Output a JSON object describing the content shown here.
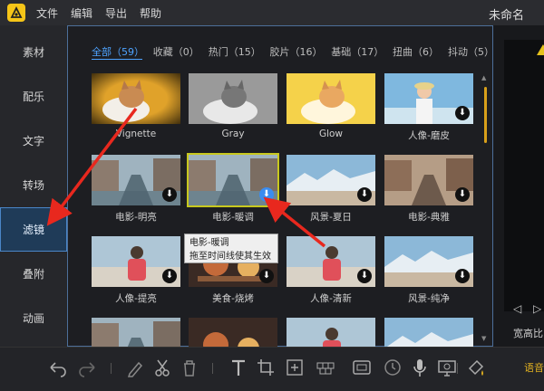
{
  "app": {
    "title": "未命名",
    "menu": [
      "文件",
      "编辑",
      "导出",
      "帮助"
    ]
  },
  "sidebar": {
    "items": [
      {
        "label": "素材",
        "active": false
      },
      {
        "label": "配乐",
        "active": false
      },
      {
        "label": "文字",
        "active": false
      },
      {
        "label": "转场",
        "active": false
      },
      {
        "label": "滤镜",
        "active": true
      },
      {
        "label": "叠附",
        "active": false
      },
      {
        "label": "动画",
        "active": false
      }
    ]
  },
  "filters": {
    "tabs": [
      {
        "label": "全部（59）",
        "active": true
      },
      {
        "label": "收藏（0）",
        "active": false
      },
      {
        "label": "热门（15）",
        "active": false
      },
      {
        "label": "胶片（16）",
        "active": false
      },
      {
        "label": "基础（17）",
        "active": false
      },
      {
        "label": "扭曲（6）",
        "active": false
      },
      {
        "label": "抖动（5）",
        "active": false
      }
    ],
    "items": [
      {
        "label": "Vignette",
        "scene": "cat-warm",
        "download": false
      },
      {
        "label": "Gray",
        "scene": "cat-gray",
        "download": false
      },
      {
        "label": "Glow",
        "scene": "cat-glow",
        "download": false
      },
      {
        "label": "人像-磨皮",
        "scene": "portrait-sky",
        "download": true
      },
      {
        "label": "电影-明亮",
        "scene": "street",
        "download": true
      },
      {
        "label": "电影-暖调",
        "scene": "street",
        "download": true,
        "selected": true
      },
      {
        "label": "风景-夏日",
        "scene": "landscape",
        "download": true
      },
      {
        "label": "电影-典雅",
        "scene": "street-warm",
        "download": true
      },
      {
        "label": "人像-提亮",
        "scene": "beach",
        "download": true
      },
      {
        "label": "美食-烧烤",
        "scene": "food",
        "download": true
      },
      {
        "label": "人像-清新",
        "scene": "beach",
        "download": true
      },
      {
        "label": "风景-纯净",
        "scene": "landscape",
        "download": true
      },
      {
        "label": "",
        "scene": "street",
        "download": false
      },
      {
        "label": "",
        "scene": "food",
        "download": false
      },
      {
        "label": "",
        "scene": "beach",
        "download": false
      },
      {
        "label": "",
        "scene": "landscape",
        "download": false
      }
    ],
    "tooltip": {
      "title": "电影-暖调",
      "hint": "拖至时间线使其生效"
    }
  },
  "preview": {
    "ratio_label": "宽高比"
  },
  "toolbar": {
    "tools": [
      "undo",
      "redo",
      "pen",
      "cut",
      "delete",
      "text",
      "crop",
      "zoom",
      "mosaic",
      "frame",
      "clock",
      "mic",
      "camera",
      "paint"
    ],
    "audio_label": "语音"
  },
  "colors": {
    "accent": "#4ea3ff",
    "brand": "#f5c518",
    "arrow": "#e8281e",
    "selected_outline": "#c8c81e"
  }
}
